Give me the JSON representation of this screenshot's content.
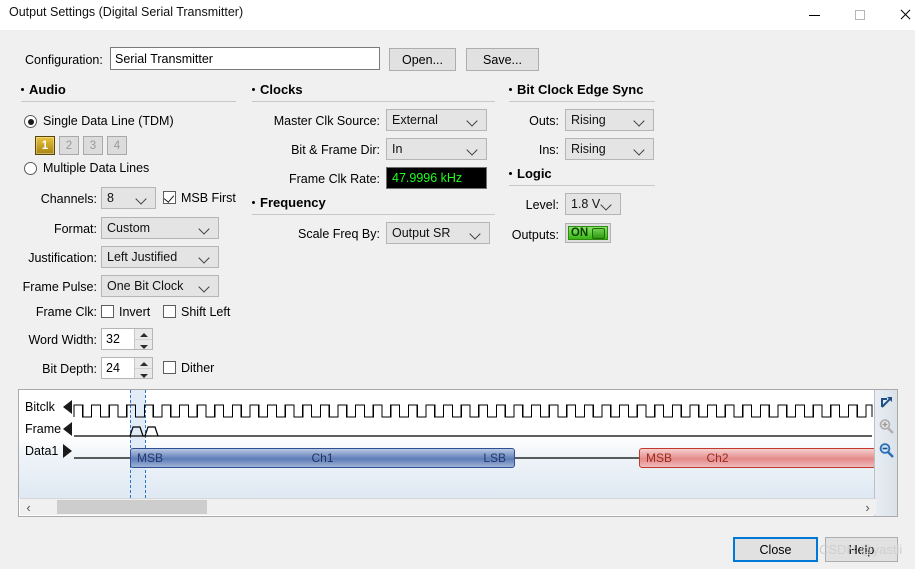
{
  "window": {
    "title": "Output Settings (Digital Serial Transmitter)",
    "minimize_label": "minimize",
    "maximize_label": "maximize",
    "close_label": "close"
  },
  "config": {
    "label": "Configuration:",
    "value": "Serial Transmitter",
    "placeholder": "",
    "open_label": "Open...",
    "save_label": "Save..."
  },
  "audio": {
    "group_label": "Audio",
    "single_data_line_label": "Single Data Line (TDM)",
    "single_data_line_selected": true,
    "line_buttons": [
      {
        "label": "1",
        "selected": true
      },
      {
        "label": "2",
        "selected": false
      },
      {
        "label": "3",
        "selected": false
      },
      {
        "label": "4",
        "selected": false
      }
    ],
    "multiple_data_lines_label": "Multiple Data Lines",
    "multiple_data_lines_selected": false,
    "channels_label": "Channels:",
    "channels_value": "8",
    "msb_first_label": "MSB First",
    "msb_first_checked": true,
    "format_label": "Format:",
    "format_value": "Custom",
    "justification_label": "Justification:",
    "justification_value": "Left Justified",
    "frame_pulse_label": "Frame Pulse:",
    "frame_pulse_value": "One Bit Clock",
    "frame_clk_label": "Frame Clk:",
    "invert_label": "Invert",
    "invert_checked": false,
    "shift_left_label": "Shift Left",
    "shift_left_checked": false,
    "word_width_label": "Word Width:",
    "word_width_value": "32",
    "bit_depth_label": "Bit Depth:",
    "bit_depth_value": "24",
    "dither_label": "Dither",
    "dither_checked": false
  },
  "clocks": {
    "group_label": "Clocks",
    "master_clk_source_label": "Master Clk Source:",
    "master_clk_source_value": "External",
    "bit_frame_dir_label": "Bit & Frame Dir:",
    "bit_frame_dir_value": "In",
    "frame_clk_rate_label": "Frame Clk Rate:",
    "frame_clk_rate_value": "47.9996 kHz",
    "frame_clk_rate_color": "#1dff1d"
  },
  "frequency": {
    "group_label": "Frequency",
    "scale_freq_by_label": "Scale Freq By:",
    "scale_freq_by_value": "Output SR"
  },
  "bit_clock_edge_sync": {
    "group_label": "Bit Clock Edge Sync",
    "outs_label": "Outs:",
    "outs_value": "Rising",
    "ins_label": "Ins:",
    "ins_value": "Rising"
  },
  "logic": {
    "group_label": "Logic",
    "level_label": "Level:",
    "level_value": "1.8 V",
    "outputs_label": "Outputs:",
    "outputs_state": "ON",
    "outputs_color": "#39b515"
  },
  "waveform": {
    "rows": [
      {
        "name": "Bitclk",
        "direction": "in"
      },
      {
        "name": "Frame",
        "direction": "in"
      },
      {
        "name": "Data1",
        "direction": "out"
      }
    ],
    "blocks": [
      {
        "left_label": "MSB",
        "center_label": "Ch1",
        "right_label": "LSB",
        "color": "#3a5fa8"
      },
      {
        "left_label": "MSB",
        "center_label": "Ch2",
        "right_label": "",
        "color": "#d03a3a"
      }
    ],
    "toolbar": {
      "popout_label": "pop-out",
      "zoom_in_label": "zoom in",
      "zoom_out_label": "zoom out"
    },
    "scroll_left_label": "‹",
    "scroll_right_label": "›"
  },
  "footer": {
    "close_label": "Close",
    "help_label": "Help",
    "watermark": "CSDN @yastli"
  }
}
